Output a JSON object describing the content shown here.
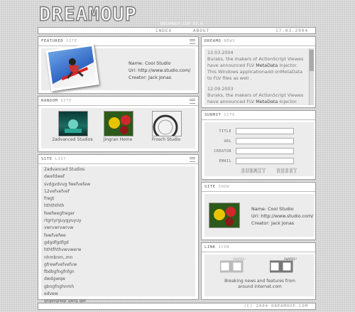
{
  "brand": {
    "logo": "DreamOup",
    "tagline": "dreamoup.com v3.0"
  },
  "nav": {
    "index": "index",
    "about": "about",
    "date": "17.03.2004"
  },
  "featured": {
    "heading_a": "featured",
    "heading_b": "site",
    "name_label": "Name:",
    "name": "Cool Studio",
    "url_label": "Url:",
    "url": "http://www.studio.com/",
    "creator_label": "Creator:",
    "creator": "Jack Jonas"
  },
  "news": {
    "heading_a": "dreamo",
    "heading_b": "news",
    "items": [
      {
        "date": "12.03.2004",
        "text_a": "Buraks, the makers of ActionScript Viewes have announced FLV ",
        "bold": "MetaData",
        "text_b": " Injector. This Windows applicationadd onMetaData to FLV files as well ."
      },
      {
        "date": "12.09.2003",
        "text_a": "Buraks, the makers of ActionScript Viewes have announced FLV ",
        "bold": "MetaData",
        "text_b": " Injector. This Windows applicationadd"
      }
    ]
  },
  "random": {
    "heading_a": "random",
    "heading_b": "site",
    "items": [
      {
        "caption": "2advanced Studios"
      },
      {
        "caption": "Jingran Home"
      },
      {
        "caption": "Frosch Studio"
      }
    ]
  },
  "submit": {
    "heading_a": "submit",
    "heading_b": "site",
    "fields": [
      "title",
      "url",
      "creator",
      "email"
    ],
    "submit_label": "submit",
    "reset_label": "reset"
  },
  "sitelist": {
    "heading_a": "site",
    "heading_b": "list",
    "items": [
      "2advanced Studios",
      "dwefdwef",
      "svdgvdvvg fwefvefew",
      "12vefvefvef",
      "fregt",
      "hthththth",
      "fewfwegfreger",
      "rtgrtyrguygyuyuy",
      "vwrvwrvwrvw",
      "fewfvefwe",
      "gdgdfgdfgd",
      "hthtfhthvwvwerw",
      "nhmbnm,.mn",
      "gfrewfvefvefvw",
      "fbdbgfngfnfgn",
      "dwdgwqw",
      "gbngfnghnmh",
      "edvew",
      "grgergregr gerg ger"
    ]
  },
  "sitesale": {
    "heading_a": "site",
    "heading_b": "show",
    "name_label": "Name:",
    "name": "Cool Studio",
    "url_label": "Url:",
    "url": "http://www.studio.com/",
    "creator_label": "Creator:",
    "creator": "Jack Jonas"
  },
  "link": {
    "heading_a": "link",
    "heading_b": "icon",
    "award_label": "awards!",
    "text": "Breaking news and features from around internet.com"
  },
  "footer": {
    "copyright": "(c) 2004 dreamoup.com"
  }
}
